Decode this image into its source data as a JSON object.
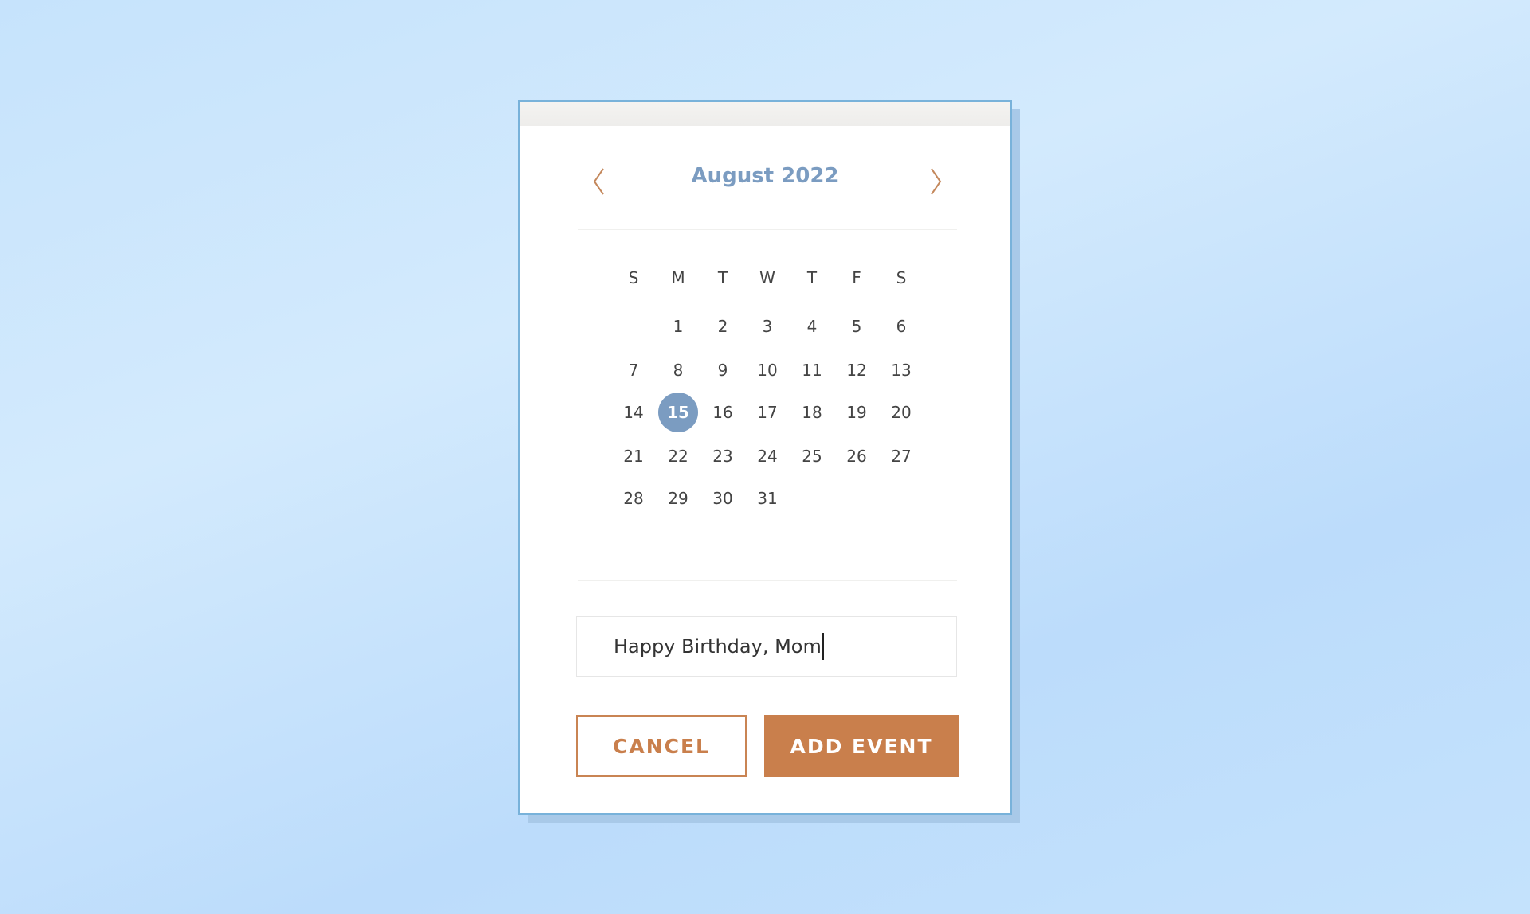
{
  "calendar": {
    "month_title": "August 2022",
    "prev_icon": "chevron-left-icon",
    "next_icon": "chevron-right-icon",
    "weekdays": [
      "S",
      "M",
      "T",
      "W",
      "T",
      "F",
      "S"
    ],
    "first_weekday_index": 1,
    "days_in_month": 31,
    "selected_day": 15
  },
  "event": {
    "input_value": "Happy Birthday, Mom"
  },
  "buttons": {
    "cancel_label": "CANCEL",
    "add_label": "ADD EVENT"
  },
  "colors": {
    "accent": "#c97f4c",
    "selected": "#7b9cc1",
    "border": "#78b2da"
  }
}
